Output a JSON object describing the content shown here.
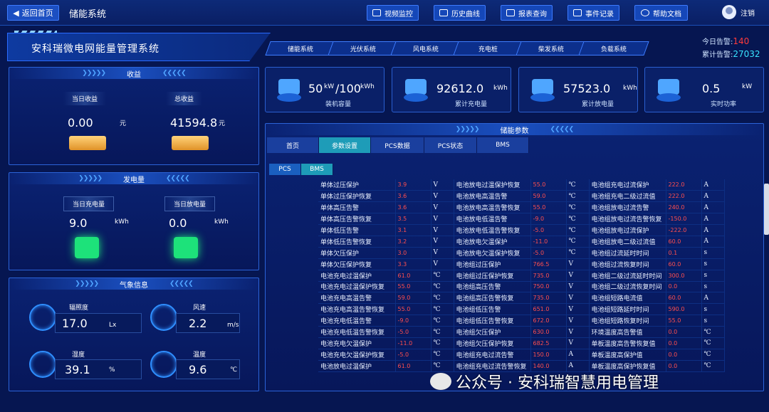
{
  "topbar": {
    "back_label": "返回首页",
    "system_name": "储能系统",
    "nav": [
      {
        "label": "视频监控",
        "icon": "video-icon"
      },
      {
        "label": "历史曲线",
        "icon": "history-icon"
      },
      {
        "label": "报表查询",
        "icon": "report-icon"
      },
      {
        "label": "事件记录",
        "icon": "event-icon"
      },
      {
        "label": "帮助文档",
        "icon": "help-icon"
      }
    ],
    "user_label": "注销"
  },
  "title": "安科瑞微电网能量管理系统",
  "systabs": [
    "储能系统",
    "光伏系统",
    "风电系统",
    "充电桩",
    "柴发系统",
    "负载系统"
  ],
  "alarms": {
    "today_label": "今日告警:",
    "today_value": "140",
    "total_label": "累计告警:",
    "total_value": "27032"
  },
  "income": {
    "title": "收益",
    "today_label": "当日收益",
    "today_value": "0.00",
    "today_unit": "元",
    "total_label": "总收益",
    "total_value": "41594.8",
    "total_unit": "元"
  },
  "power": {
    "title": "发电量",
    "charge_label": "当日充电量",
    "charge_value": "9.0",
    "charge_unit": "kWh",
    "discharge_label": "当日放电量",
    "discharge_value": "0.0",
    "discharge_unit": "kWh"
  },
  "weather": {
    "title": "气象信息",
    "irradiance": {
      "label": "辐照度",
      "value": "17.0",
      "unit": "Lx"
    },
    "wind": {
      "label": "风速",
      "value": "2.2",
      "unit": "m/s"
    },
    "humidity": {
      "label": "湿度",
      "value": "39.1",
      "unit": "%"
    },
    "temperature": {
      "label": "温度",
      "value": "9.6",
      "unit": "℃"
    }
  },
  "stats": [
    {
      "value": "50",
      "value_unit": "kW",
      "sep": "/100",
      "sep_unit": "kWh",
      "label": "装机容量"
    },
    {
      "value": "92612.0",
      "unit": "kWh",
      "label": "累计充电量"
    },
    {
      "value": "57523.0",
      "unit": "kWh",
      "label": "累计放电量"
    },
    {
      "value": "0.5",
      "unit": "kW",
      "label": "实时功率"
    }
  ],
  "params_panel": {
    "title": "储能参数",
    "tabs": [
      "首页",
      "参数设置",
      "PCS数据",
      "PCS状态",
      "BMS"
    ],
    "active_tab": "参数设置",
    "subtabs": [
      "PCS",
      "BMS"
    ],
    "active_subtab": "BMS"
  },
  "params": [
    [
      "单体过压保护",
      "3.9",
      "V",
      "电池放电过温保护恢复",
      "55.0",
      "℃",
      "电池组充电过流保护",
      "222.0",
      "A"
    ],
    [
      "单体过压保护恢复",
      "3.6",
      "V",
      "电池放电高温告警",
      "59.0",
      "℃",
      "电池组充电二级过流值",
      "222.0",
      "A"
    ],
    [
      "单体高压告警",
      "3.6",
      "V",
      "电池放电高温告警恢复",
      "55.0",
      "℃",
      "电池组放电过流告警",
      "240.0",
      "A"
    ],
    [
      "单体高压告警恢复",
      "3.5",
      "V",
      "电池放电低温告警",
      "-9.0",
      "℃",
      "电池组放电过流告警恢复",
      "-150.0",
      "A"
    ],
    [
      "单体低压告警",
      "3.1",
      "V",
      "电池放电低温告警恢复",
      "-5.0",
      "℃",
      "电池组放电过流保护",
      "-222.0",
      "A"
    ],
    [
      "单体低压告警恢复",
      "3.2",
      "V",
      "电池放电欠温保护",
      "-11.0",
      "℃",
      "电池组放电二级过流值",
      "60.0",
      "A"
    ],
    [
      "单体欠压保护",
      "3.0",
      "V",
      "电池放电欠温保护恢复",
      "-5.0",
      "℃",
      "电池组过流延时时间",
      "0.1",
      "s"
    ],
    [
      "单体欠压保护恢复",
      "3.3",
      "V",
      "电池组过压保护",
      "766.5",
      "V",
      "电池组过流恢复时间",
      "60.0",
      "s"
    ],
    [
      "电池充电过温保护",
      "61.0",
      "℃",
      "电池组过压保护恢复",
      "735.0",
      "V",
      "电池组二级过流延时时间",
      "300.0",
      "s"
    ],
    [
      "电池充电过温保护恢复",
      "55.0",
      "℃",
      "电池组高压告警",
      "750.0",
      "V",
      "电池组二级过流恢复时间",
      "0.0",
      "s"
    ],
    [
      "电池充电高温告警",
      "59.0",
      "℃",
      "电池组高压告警恢复",
      "735.0",
      "V",
      "电池组短路电流值",
      "60.0",
      "A"
    ],
    [
      "电池充电高温告警恢复",
      "55.0",
      "℃",
      "电池组低压告警",
      "651.0",
      "V",
      "电池组短路延时时间",
      "590.0",
      "s"
    ],
    [
      "电池充电低温告警",
      "-9.0",
      "℃",
      "电池组低压告警恢复",
      "672.0",
      "V",
      "电池组短路恢复时间",
      "55.0",
      "s"
    ],
    [
      "电池充电低温告警恢复",
      "-5.0",
      "℃",
      "电池组欠压保护",
      "630.0",
      "V",
      "环境温度高告警值",
      "0.0",
      "℃"
    ],
    [
      "电池充电欠温保护",
      "-11.0",
      "℃",
      "电池组欠压保护恢复",
      "682.5",
      "V",
      "单板温度高告警恢复值",
      "0.0",
      "℃"
    ],
    [
      "电池充电欠温保护恢复",
      "-5.0",
      "℃",
      "电池组充电过流告警",
      "150.0",
      "A",
      "单板温度高保护值",
      "0.0",
      "℃"
    ],
    [
      "电池放电过温保护",
      "61.0",
      "℃",
      "电池组充电过流告警恢复",
      "140.0",
      "A",
      "单板温度高保护恢复值",
      "0.0",
      "℃"
    ]
  ],
  "watermark": "公众号 · 安科瑞智慧用电管理"
}
